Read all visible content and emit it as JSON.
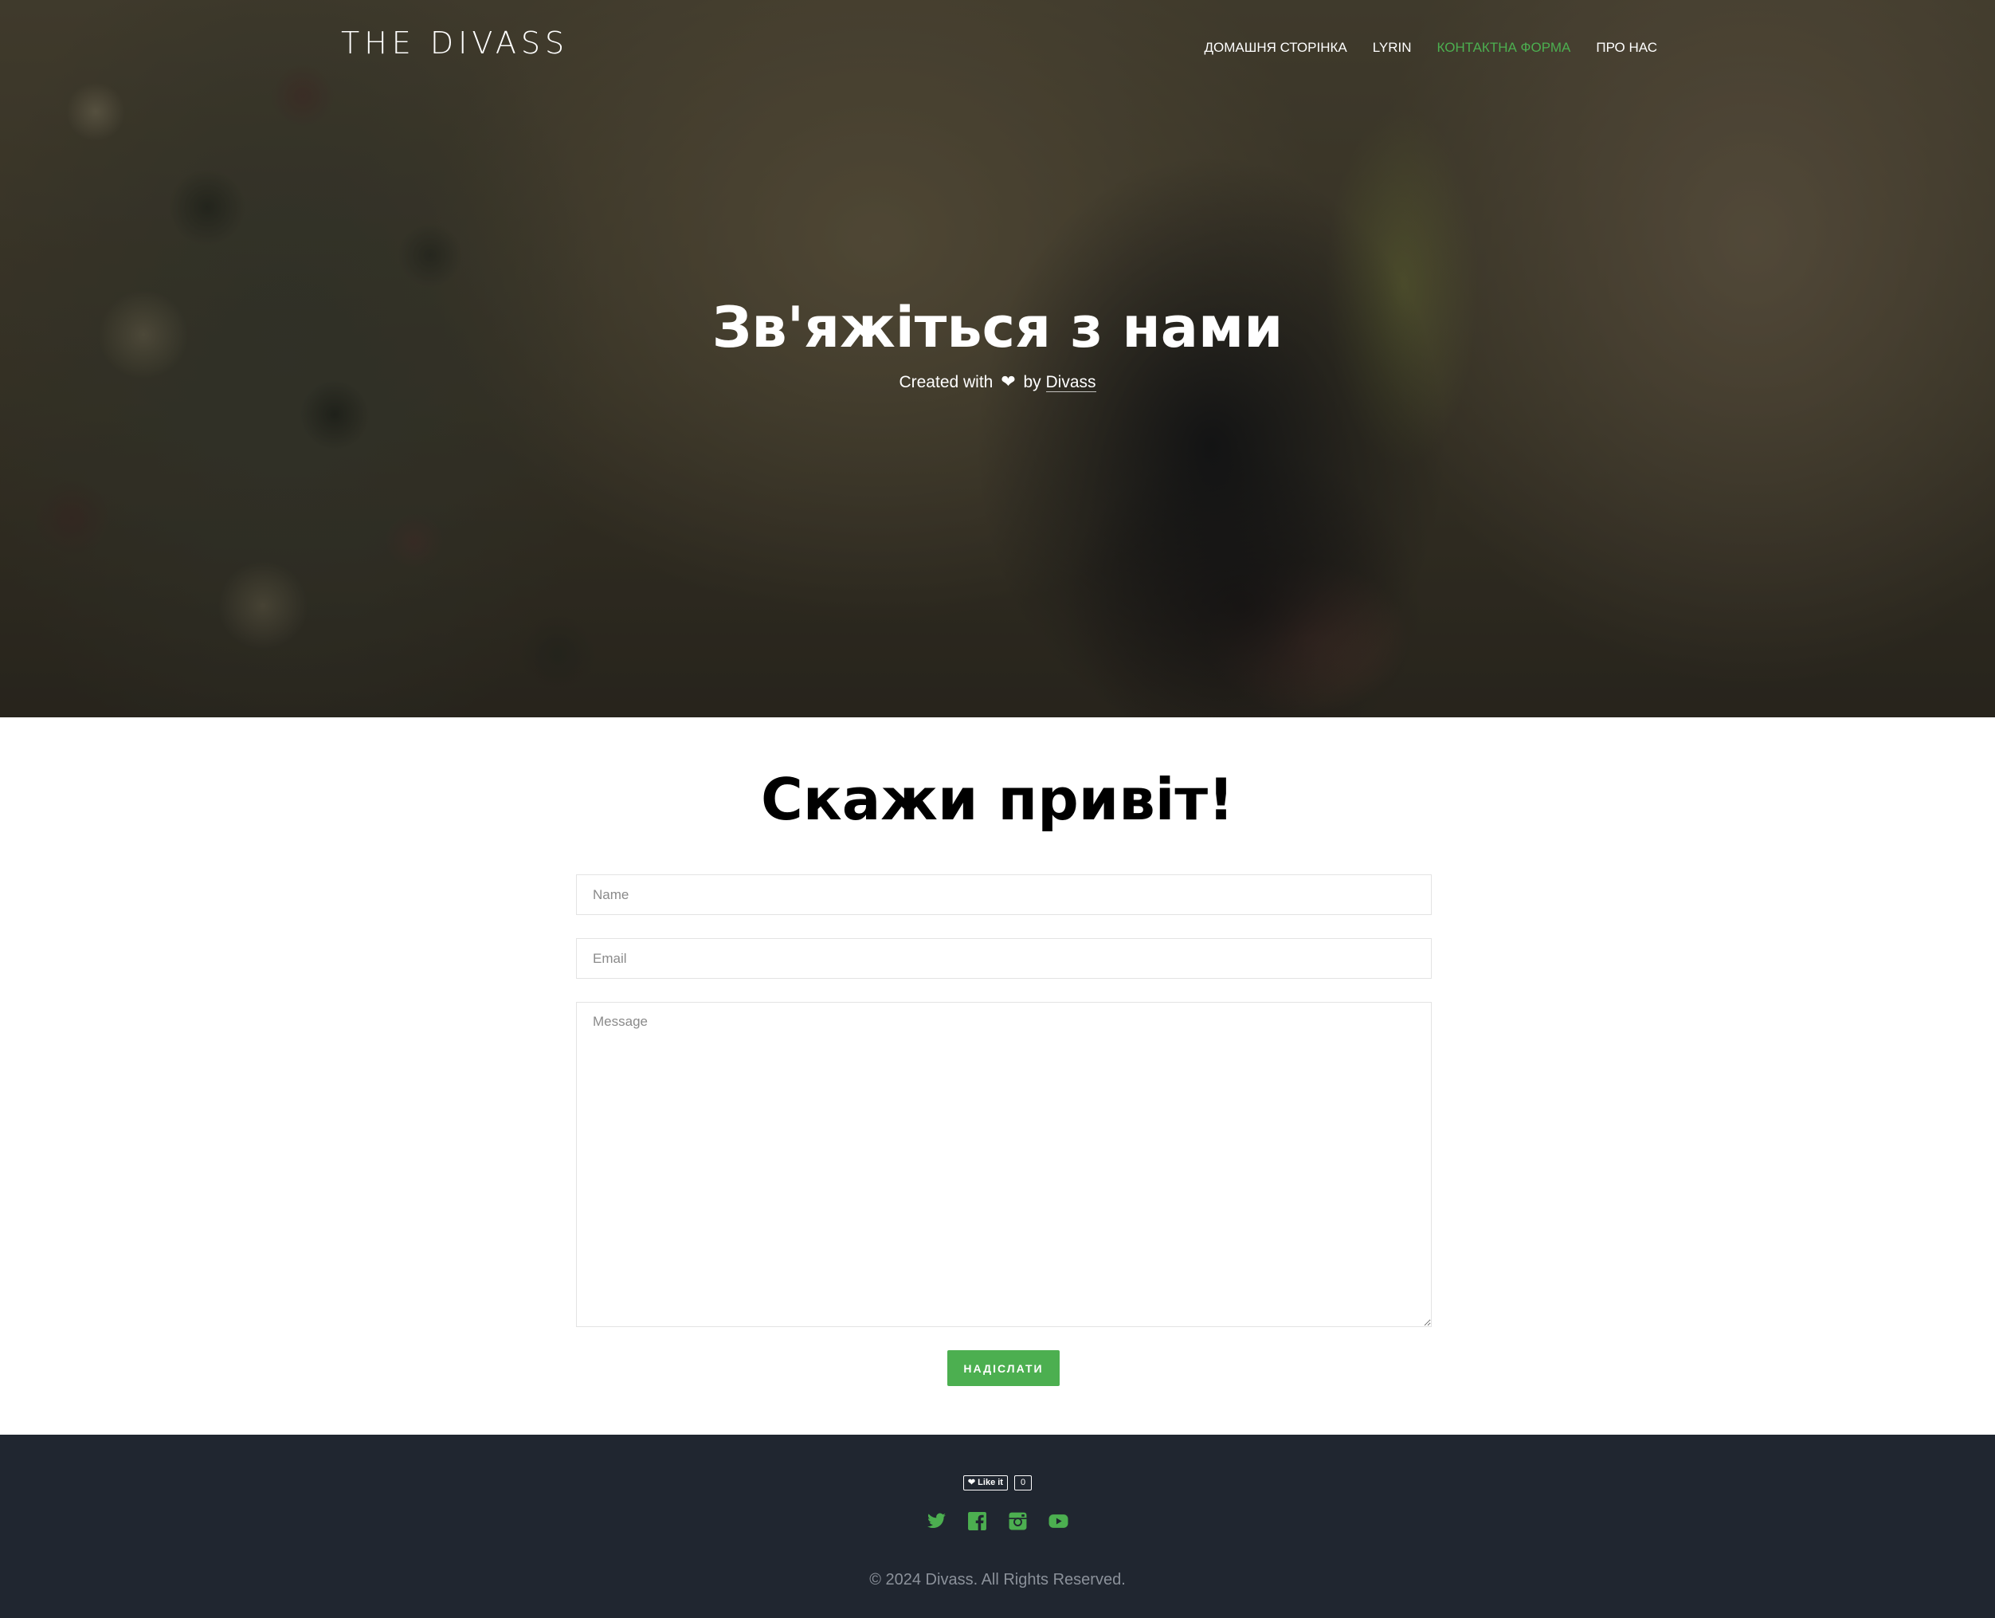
{
  "header": {
    "logo": "THE DIVASS",
    "nav": [
      {
        "label": "ДОМАШНЯ СТОРІНКА",
        "active": false
      },
      {
        "label": "LYRIN",
        "active": false
      },
      {
        "label": "КОНТАКТНА ФОРМА",
        "active": true
      },
      {
        "label": "ПРО НАС",
        "active": false
      }
    ]
  },
  "hero": {
    "title": "Зв'яжіться з нами",
    "created_prefix": "Created with",
    "heart_icon": "heart-icon",
    "by": "by",
    "author": "Divass"
  },
  "contact": {
    "title": "Скажи привіт!",
    "name_placeholder": "Name",
    "email_placeholder": "Email",
    "message_placeholder": "Message",
    "submit_label": "НАДІСЛАТИ"
  },
  "footer": {
    "like_label": "❤ Like it",
    "like_count": "0",
    "social_icons": [
      "twitter-icon",
      "facebook-icon",
      "instagram-icon",
      "youtube-icon"
    ],
    "copyright": "© 2024 Divass. All Rights Reserved."
  },
  "colors": {
    "accent": "#4caf50",
    "footer_bg": "#202630"
  }
}
